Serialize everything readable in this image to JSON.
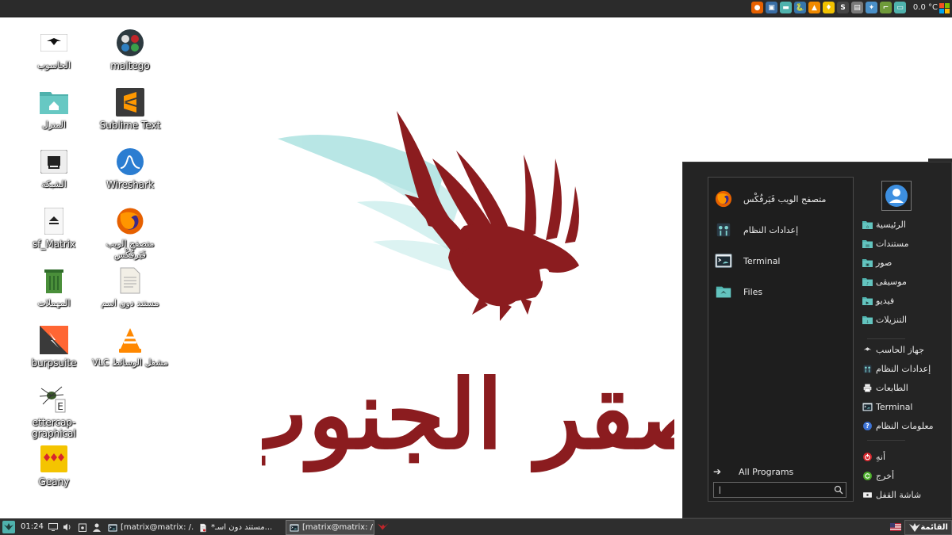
{
  "top_panel": {
    "temperature": "0.0 °C",
    "tray_icons": [
      {
        "name": "firefox-icon",
        "color": "#e66000",
        "glyph": "●"
      },
      {
        "name": "picture-icon",
        "color": "#3a6ea5",
        "glyph": "▣"
      },
      {
        "name": "folder-icon",
        "color": "#4fb2ad",
        "glyph": "▬"
      },
      {
        "name": "python-icon",
        "color": "#3776ab",
        "glyph": "🐍"
      },
      {
        "name": "vlc-icon",
        "color": "#f08a00",
        "glyph": "▲"
      },
      {
        "name": "geany-icon",
        "color": "#f2c200",
        "glyph": "♦"
      },
      {
        "name": "sublime-icon",
        "color": "#454545",
        "glyph": "S"
      },
      {
        "name": "office-icon",
        "color": "#7a7a7a",
        "glyph": "▤"
      },
      {
        "name": "wizard-icon",
        "color": "#4a90c8",
        "glyph": "✦"
      },
      {
        "name": "broom-icon",
        "color": "#6f9a3a",
        "glyph": "⌐"
      },
      {
        "name": "display-icon",
        "color": "#4fb2ad",
        "glyph": "▭"
      }
    ]
  },
  "desktop": {
    "icons": [
      {
        "id": "computer",
        "label": "الحاسوب",
        "lang": "ar"
      },
      {
        "id": "maltego",
        "label": "maltego",
        "lang": "en"
      },
      {
        "id": "home",
        "label": "المنزل",
        "lang": "ar"
      },
      {
        "id": "sublime",
        "label": "Sublime Text",
        "lang": "en"
      },
      {
        "id": "network",
        "label": "الشبكة",
        "lang": "ar"
      },
      {
        "id": "wireshark",
        "label": "Wireshark",
        "lang": "en"
      },
      {
        "id": "sf_matrix",
        "label": "sf_Matrix",
        "lang": "en"
      },
      {
        "id": "firefox",
        "label": "متصفح الويب فَيَرفُكْس",
        "lang": "ar"
      },
      {
        "id": "trash",
        "label": "المهملات",
        "lang": "ar"
      },
      {
        "id": "untitled-doc",
        "label": "مستند دون اسم",
        "lang": "ar"
      },
      {
        "id": "burpsuite",
        "label": "burpsuite",
        "lang": "en"
      },
      {
        "id": "vlc",
        "label": "مشغل الوسائط VLC",
        "lang": "ar"
      },
      {
        "id": "ettercap",
        "label": "ettercap-graphical",
        "lang": "en"
      },
      {
        "id": "geany",
        "label": "Geany",
        "lang": "en"
      }
    ]
  },
  "wallpaper": {
    "title": "صقر الجنوب",
    "colors": {
      "bird": "#8b1c1f",
      "wing_glow": "#7fd3d0"
    }
  },
  "start_menu": {
    "favorites": [
      {
        "label": "متصفح الويب فَيَرفُكْس",
        "icon": "firefox-icon"
      },
      {
        "label": "إعدادات النظام",
        "icon": "settings-icon"
      },
      {
        "label": "Terminal",
        "icon": "terminal-icon"
      },
      {
        "label": "Files",
        "icon": "files-icon"
      }
    ],
    "all_programs": "All Programs",
    "search_value": "|",
    "places": [
      {
        "label": "الرئيسية",
        "icon": "home-folder-icon"
      },
      {
        "label": "مستندات",
        "icon": "documents-folder-icon"
      },
      {
        "label": "صور",
        "icon": "pictures-folder-icon"
      },
      {
        "label": "موسيقى",
        "icon": "music-folder-icon"
      },
      {
        "label": "فيديو",
        "icon": "video-folder-icon"
      },
      {
        "label": "التنزيلات",
        "icon": "downloads-folder-icon"
      }
    ],
    "system": [
      {
        "label": "جهاز الحاسب",
        "icon": "computer-icon"
      },
      {
        "label": "إعدادات النظام",
        "icon": "settings-icon"
      },
      {
        "label": "الطابعات",
        "icon": "printer-icon"
      },
      {
        "label": "Terminal",
        "icon": "terminal-icon"
      },
      {
        "label": "معلومات النظام",
        "icon": "help-icon"
      }
    ],
    "session": [
      {
        "label": "أنهِ",
        "icon": "power-icon"
      },
      {
        "label": "أخرج",
        "icon": "logout-icon"
      },
      {
        "label": "شاشة القفل",
        "icon": "lock-screen-icon"
      }
    ]
  },
  "taskbar": {
    "clock": "01:24",
    "tasks": [
      {
        "label": "[matrix@matrix: /...",
        "icon": "terminal-icon",
        "active": false
      },
      {
        "label": "*مستند دون اسـ...",
        "icon": "document-icon",
        "active": false
      },
      {
        "label": "[matrix@matrix: /...",
        "icon": "terminal-icon",
        "active": true
      }
    ],
    "menu_label": "القائمة"
  }
}
